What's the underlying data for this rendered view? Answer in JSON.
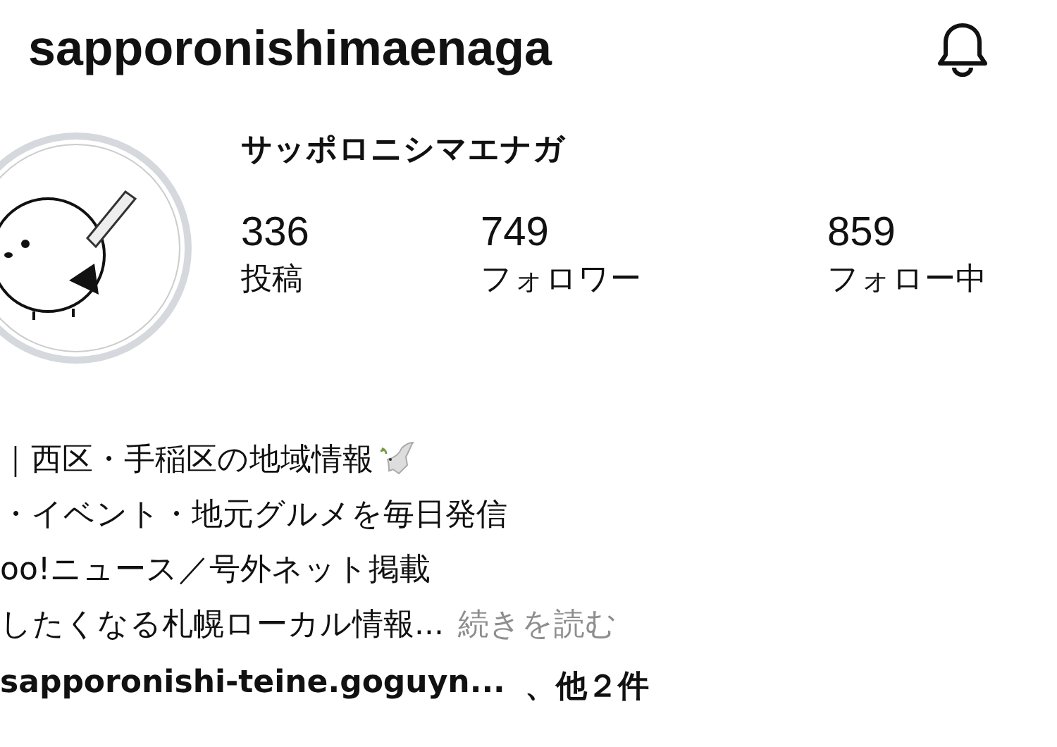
{
  "header": {
    "username": "sapporonishimaenaga"
  },
  "profile": {
    "display_name": "サッポロニシマエナガ",
    "stats": [
      {
        "count": "336",
        "label": "投稿"
      },
      {
        "count": "749",
        "label": "フォロワー"
      },
      {
        "count": "859",
        "label": "フォロー中"
      }
    ]
  },
  "bio": {
    "lines": [
      "｜西区・手稲区の地域情報",
      "・イベント・地元グルメを毎日発信",
      "oo!ニュース／号外ネット掲載",
      "したくなる札幌ローカル情報..."
    ],
    "more_link": "続きを読む"
  },
  "links": {
    "url": "sapporonishi-teine.goguyn...",
    "more": "、他２件"
  }
}
